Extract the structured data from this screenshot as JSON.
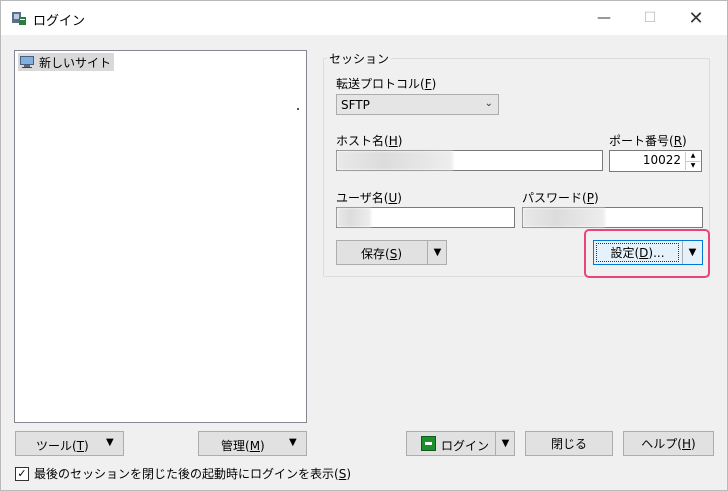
{
  "window": {
    "title": "ログイン",
    "controls": {
      "minimize": "—",
      "maximize": "☐",
      "close": "✕"
    }
  },
  "site_tree": {
    "items": [
      {
        "label": "新しいサイト",
        "icon": "computer-icon"
      }
    ]
  },
  "session": {
    "group_caption": "セッション",
    "protocol_label": "転送プロトコル(",
    "protocol_key": "F",
    "protocol_close": ")",
    "protocol_value": "SFTP",
    "host_label": "ホスト名(",
    "host_key": "H",
    "host_close": ")",
    "port_label": "ポート番号(",
    "port_key": "R",
    "port_close": ")",
    "port_value": "10022",
    "user_label": "ユーザ名(",
    "user_key": "U",
    "user_close": ")",
    "password_label": "パスワード(",
    "password_key": "P",
    "password_close": ")",
    "save_label": "保存(",
    "save_key": "S",
    "save_close": ")",
    "settings_label": "設定(",
    "settings_key": "D",
    "settings_close": ")..."
  },
  "bottom": {
    "tools_label": "ツール(",
    "tools_key": "T",
    "tools_close": ")",
    "manage_label": "管理(",
    "manage_key": "M",
    "manage_close": ")",
    "login_label": "ログイン",
    "close_label": "閉じる",
    "help_label": "ヘルプ(",
    "help_key": "H",
    "help_close": ")",
    "show_login_text": "最後のセッションを閉じた後の起動時にログインを表示(",
    "show_login_key": "S",
    "show_login_close": ")",
    "show_login_checked": true
  },
  "colors": {
    "highlight": "#e8437c",
    "focus": "#0078d7"
  }
}
